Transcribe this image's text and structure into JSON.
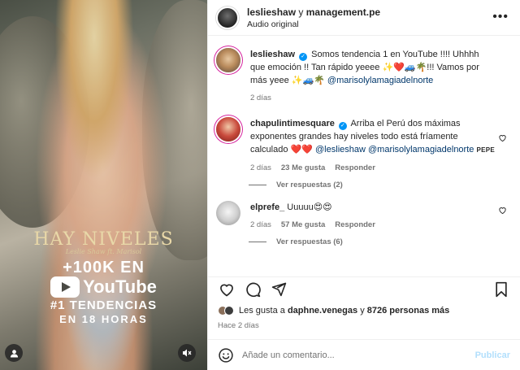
{
  "media": {
    "overlay_title": "HAY NIVELES",
    "overlay_subtitle": "Leslie Shaw ft. Marisol",
    "views": "+100K EN",
    "platform": "YouTube",
    "trend": "#1 TENDENCIAS",
    "hours": "EN 18 HORAS"
  },
  "header": {
    "username": "leslieshaw",
    "connector": "y",
    "collaborator": "management.pe",
    "audio": "Audio original",
    "more_glyph": "•••"
  },
  "caption": {
    "username": "leslieshaw",
    "text_a": "Somos tendencia 1 en YouTube !!!! Uhhhh que emoción !! Tan rápido yeeee ",
    "emojis_a": "✨❤️🚙🌴",
    "text_b": "!!! Vamos por más yeee ",
    "emojis_b": "✨🚙🌴",
    "mention": "@marisolylamagiadelnorte",
    "age": "2 días"
  },
  "comments": [
    {
      "username": "chapulintimesquare",
      "text": "Arriba el Perú dos máximas exponentes grandes hay niveles todo está fríamente calculado ",
      "emojis": "❤️❤️",
      "mention1": "@leslieshaw",
      "mention2": "@marisolylamagiadelnorte",
      "tag": "PEPE",
      "age": "2 días",
      "likes": "23 Me gusta",
      "reply_label": "Responder",
      "replies": "Ver respuestas (2)"
    },
    {
      "username": "elprefe_",
      "text": "Uuuuu",
      "emojis": "😍😍",
      "age": "2 días",
      "likes": "57 Me gusta",
      "reply_label": "Responder",
      "replies": "Ver respuestas (6)"
    }
  ],
  "likes": {
    "prefix": "Les gusta a",
    "user": "daphne.venegas",
    "joiner": "y",
    "others": "8726 personas más"
  },
  "posted": "Hace 2 días",
  "composer": {
    "placeholder": "Añade un comentario...",
    "publish": "Publicar"
  },
  "colors": {
    "verified": "#0095f6",
    "mention": "#00376b",
    "publish_disabled": "#b2dffc"
  },
  "icons": [
    "heart-icon",
    "comment-icon",
    "share-icon",
    "bookmark-icon",
    "emoji-icon",
    "user-icon",
    "mute-icon",
    "verified-icon",
    "more-icon"
  ]
}
